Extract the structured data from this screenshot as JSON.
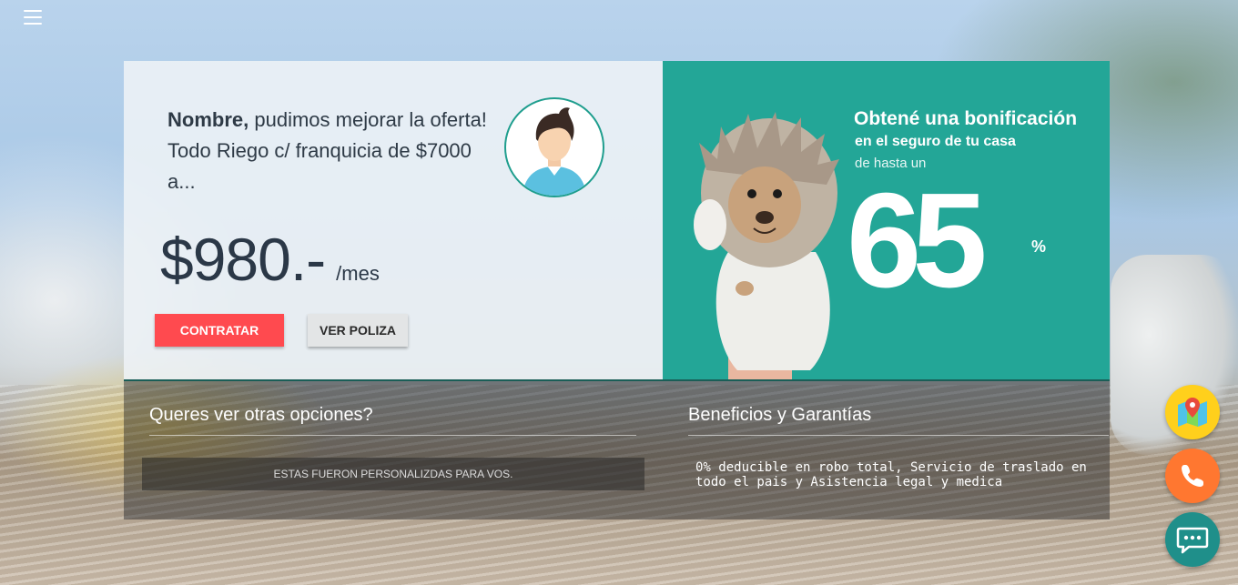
{
  "header": {
    "menu_icon": "hamburger-menu-icon"
  },
  "offer": {
    "name": "Nombre,",
    "message": " pudimos mejorar la oferta! Todo Riego c/ franquicia de $7000 a...",
    "price": "$980.-",
    "period": "/mes",
    "contratar_label": "CONTRATAR",
    "ver_poliza_label": "VER POLIZA",
    "avatar_icon": "user-avatar-icon"
  },
  "promo": {
    "title": "Obtené una bonificación",
    "subtitle": "en el seguro de tu casa",
    "subtitle2": "de hasta un",
    "number": "65",
    "percent": "%"
  },
  "options": {
    "title": "Queres ver otras opciones?",
    "personalized": "ESTAS FUERON PERSONALIZDAS PARA VOS."
  },
  "benefits": {
    "title": "Beneficios y Garantías",
    "text": "0% deducible en robo total, Servicio de traslado en todo el pais y Asistencia legal y medica"
  },
  "floating_actions": [
    {
      "icon": "map-location-icon",
      "color": "#ffd01c"
    },
    {
      "icon": "phone-icon",
      "color": "#ff7730"
    },
    {
      "icon": "chat-bubble-icon",
      "color": "#1f8f8a"
    }
  ],
  "colors": {
    "accent_red": "#ff4a4f",
    "promo_teal": "#23a697",
    "text_dark": "#2e3a46"
  }
}
